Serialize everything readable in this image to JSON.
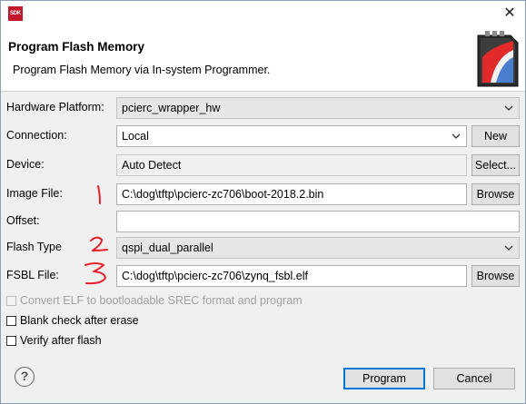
{
  "window": {
    "app_icon_text": "SDK",
    "close_glyph": "✕"
  },
  "header": {
    "title": "Program Flash Memory",
    "description": "Program Flash Memory via In-system Programmer."
  },
  "form": {
    "hardware_platform": {
      "label": "Hardware Platform:",
      "value": "pcierc_wrapper_hw"
    },
    "connection": {
      "label": "Connection:",
      "value": "Local",
      "button": "New"
    },
    "device": {
      "label": "Device:",
      "value": "Auto Detect",
      "button": "Select..."
    },
    "image_file": {
      "label": "Image File:",
      "value": "C:\\dog\\tftp\\pcierc-zc706\\boot-2018.2.bin",
      "button": "Browse"
    },
    "offset": {
      "label": "Offset:",
      "value": ""
    },
    "flash_type": {
      "label": "Flash Type",
      "value": "qspi_dual_parallel"
    },
    "fsbl_file": {
      "label": "FSBL File:",
      "value": "C:\\dog\\tftp\\pcierc-zc706\\zynq_fsbl.elf",
      "button": "Browse"
    }
  },
  "options": {
    "convert_elf": {
      "label": "Convert ELF to bootloadable SREC format and program",
      "checked": false,
      "disabled": true
    },
    "blank_check": {
      "label": "Blank check after erase",
      "checked": false
    },
    "verify": {
      "label": "Verify after flash",
      "checked": false
    }
  },
  "footer": {
    "help_glyph": "?",
    "program_button": "Program",
    "cancel_button": "Cancel"
  },
  "colors": {
    "annotation_red": "#e8202a",
    "primary_border": "#0078d7"
  },
  "icons": [
    "sdk-app-icon",
    "close-icon",
    "flash-memory-banner-icon",
    "chevron-down-icon",
    "help-icon"
  ]
}
